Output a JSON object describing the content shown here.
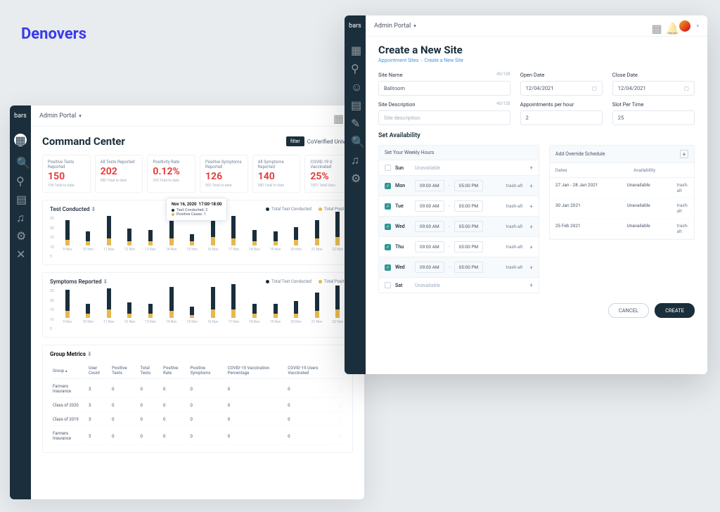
{
  "brand": "Denovers",
  "dashboard": {
    "topbar": {
      "logo": "bars",
      "title": "Admin Portal"
    },
    "pageTitle": "Command Center",
    "filter": {
      "button": "filter",
      "text": "CoVerified Univers"
    },
    "metrics": [
      {
        "label": "Positive Tests Reported",
        "value": "150",
        "sub": "196 Total to date"
      },
      {
        "label": "All Tests Reported",
        "value": "202",
        "sub": "500 Total to date"
      },
      {
        "label": "Positivity Rate",
        "value": "0.12%",
        "sub": "230 Total to date"
      },
      {
        "label": "Positive Symptoms Reported",
        "value": "126",
        "sub": "502 Total to date"
      },
      {
        "label": "All Symptoms Reported",
        "value": "140",
        "sub": "580 Total to date"
      },
      {
        "label": "COVID-19 U Vaccinated",
        "value": "25%",
        "sub": "1501 Total Vacc"
      }
    ],
    "charts": {
      "test": {
        "title": "Test Conducted",
        "legend": [
          {
            "color": "#1a2e3b",
            "label": "Total Test Conducted"
          },
          {
            "color": "#e6b94f",
            "label": "Total Positi"
          }
        ],
        "tooltip": {
          "date": "Nov 16, 2020",
          "time": "17:00-18:00",
          "rows": [
            {
              "color": "#1a2e3b",
              "text": "Test Conducted: 2"
            },
            {
              "color": "#e6b94f",
              "text": "Positive Cases: 1"
            }
          ]
        }
      },
      "symptoms": {
        "title": "Symptoms Reported",
        "legend": [
          {
            "color": "#1a2e3b",
            "label": "Total Test Conducted"
          },
          {
            "color": "#e6b94f",
            "label": "Total Positi"
          }
        ]
      }
    },
    "groupMetrics": {
      "title": "Group Metrics",
      "columns": [
        "Group",
        "User Count",
        "Positive Tests",
        "Total Tests",
        "Positive Rate",
        "Positive Symptoms",
        "COVID-19 Vaccination Percentage",
        "COVID-19 Users Vaccinated",
        ""
      ],
      "rows": [
        [
          "Farmers Insurance",
          "3",
          "0",
          "0",
          "0",
          "0",
          "0",
          "0",
          "⋮"
        ],
        [
          "Class of 2020",
          "3",
          "0",
          "0",
          "0",
          "0",
          "0",
          "0",
          "⋮"
        ],
        [
          "Class of 2019",
          "3",
          "0",
          "0",
          "0",
          "0",
          "0",
          "0",
          "⋮"
        ],
        [
          "Farmers Insurance",
          "3",
          "0",
          "0",
          "0",
          "0",
          "0",
          "0",
          "⋮"
        ]
      ]
    }
  },
  "form": {
    "topbar": {
      "logo": "bars",
      "title": "Admin Portal"
    },
    "pageTitle": "Create a New Site",
    "breadcrumb": {
      "parent": "Appointment Sites",
      "current": "Create a New Site"
    },
    "siteName": {
      "label": "Site Name",
      "value": "Ballroom",
      "counter": "40/128"
    },
    "openDate": {
      "label": "Open Date",
      "value": "12/04/2021"
    },
    "closeDate": {
      "label": "Close Date",
      "value": "12/04/2021"
    },
    "siteDesc": {
      "label": "Site Description",
      "placeholder": "Site description",
      "counter": "40/128"
    },
    "apptPerHour": {
      "label": "Appointments per hour",
      "value": "2"
    },
    "slotPerTime": {
      "label": "Slot Per Time",
      "value": "25"
    },
    "sectionTitle": "Set Availability",
    "weeklyHead": "Set Your Weekly Hours",
    "overrideHead": "Add Override Schedule",
    "days": [
      {
        "on": false,
        "name": "Sun",
        "unavail": true
      },
      {
        "on": true,
        "name": "Mon",
        "from": "09:00 AM",
        "to": "05:00 PM",
        "shade": true
      },
      {
        "on": true,
        "name": "Tue",
        "from": "09:00 AM",
        "to": "05:00 PM"
      },
      {
        "on": true,
        "name": "Wed",
        "from": "09:00 AM",
        "to": "05:00 PM",
        "shade": true
      },
      {
        "on": true,
        "name": "Thu",
        "from": "09:00 AM",
        "to": "05:00 PM"
      },
      {
        "on": true,
        "name": "Wed",
        "from": "09:00 AM",
        "to": "05:00 PM",
        "shade": true
      },
      {
        "on": false,
        "name": "Sat",
        "unavail": true
      }
    ],
    "trashLabel": "trash-alt",
    "unavailLabel": "Unavailable",
    "overrideCols": {
      "dates": "Dates",
      "avail": "Availability"
    },
    "overrides": [
      {
        "dates": "27 Jan - 28 Jan 2021",
        "avail": "Unavailable"
      },
      {
        "dates": "30 Jan 2021",
        "avail": "Unavailable"
      },
      {
        "dates": "25 Feb 2021",
        "avail": "Unavailable"
      }
    ],
    "buttons": {
      "cancel": "CANCEL",
      "create": "CREATE"
    }
  },
  "chart_data": [
    {
      "type": "bar",
      "title": "Test Conducted",
      "ylim": [
        0,
        25
      ],
      "yticks": [
        25,
        20,
        15,
        10,
        5
      ],
      "categories": [
        "9 Nov",
        "10 Nov",
        "11 Nov",
        "12 Nov",
        "13 Nov",
        "14 Nov",
        "15 Nov",
        "16 Nov",
        "17 Nov",
        "18 Nov",
        "19 Nov",
        "20 Nov",
        "21 Nov",
        "22 Nov"
      ],
      "series": [
        {
          "name": "Total Test Conducted",
          "color": "#1a2e3b",
          "values": [
            18,
            10,
            21,
            12,
            11,
            20,
            8,
            22,
            21,
            11,
            10,
            13,
            18,
            24
          ]
        },
        {
          "name": "Total Positive",
          "color": "#e6b94f",
          "values": [
            4,
            3,
            5,
            3,
            3,
            5,
            3,
            6,
            5,
            3,
            3,
            4,
            5,
            6
          ]
        }
      ]
    },
    {
      "type": "bar",
      "title": "Symptoms Reported",
      "ylim": [
        0,
        25
      ],
      "yticks": [
        25,
        20,
        15,
        10,
        5
      ],
      "categories": [
        "9 Nov",
        "10 Nov",
        "11 Nov",
        "12 Nov",
        "13 Nov",
        "14 Nov",
        "15 Nov",
        "16 Nov",
        "17 Nov",
        "18 Nov",
        "19 Nov",
        "20 Nov",
        "21 Nov",
        "22 Nov"
      ],
      "series": [
        {
          "name": "Total Test Conducted",
          "color": "#1a2e3b",
          "values": [
            20,
            10,
            21,
            11,
            10,
            22,
            8,
            22,
            24,
            10,
            10,
            12,
            18,
            23
          ]
        },
        {
          "name": "Total Positive",
          "color": "#e6b94f",
          "values": [
            5,
            3,
            6,
            3,
            3,
            5,
            2,
            6,
            6,
            3,
            3,
            3,
            5,
            6
          ]
        }
      ]
    }
  ]
}
